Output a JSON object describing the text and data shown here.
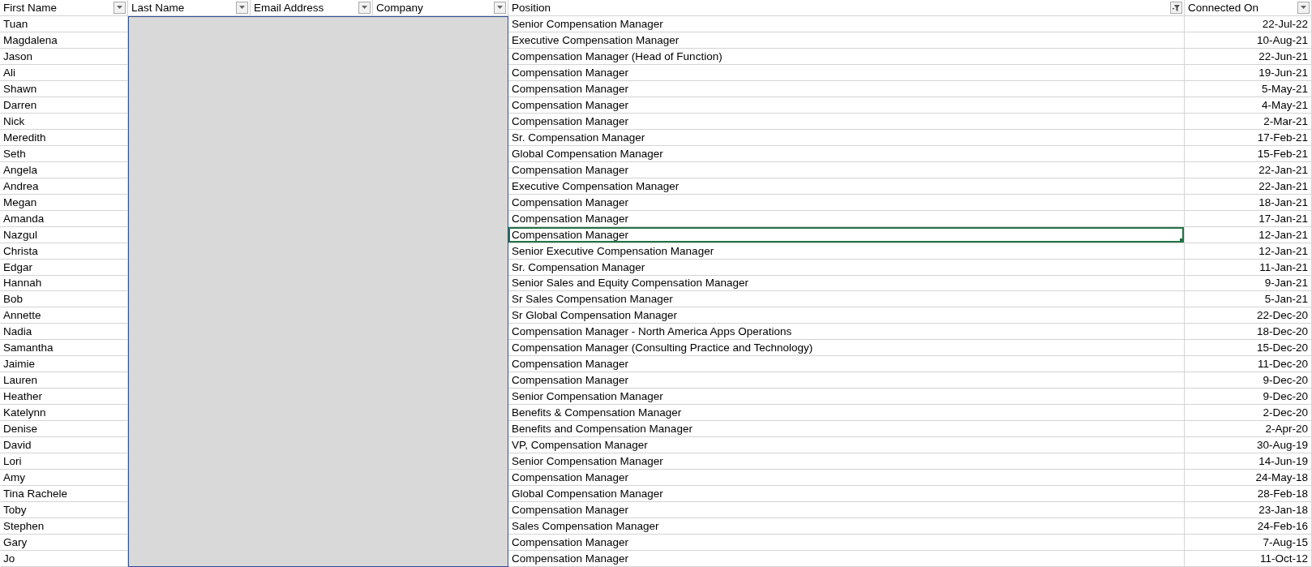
{
  "columns": [
    {
      "label": "First Name",
      "kind": "dropdown"
    },
    {
      "label": "Last Name",
      "kind": "dropdown"
    },
    {
      "label": "Email Address",
      "kind": "dropdown"
    },
    {
      "label": "Company",
      "kind": "dropdown"
    },
    {
      "label": "Position",
      "kind": "filtered"
    },
    {
      "label": "Connected On",
      "kind": "dropdown"
    }
  ],
  "rows": [
    {
      "first_name": "Tuan",
      "position": "Senior Compensation Manager",
      "connected_on": "22-Jul-22",
      "selected": false
    },
    {
      "first_name": "Magdalena",
      "position": "Executive Compensation Manager",
      "connected_on": "10-Aug-21",
      "selected": false
    },
    {
      "first_name": "Jason",
      "position": "Compensation Manager (Head of Function)",
      "connected_on": "22-Jun-21",
      "selected": false
    },
    {
      "first_name": "Ali",
      "position": "Compensation Manager",
      "connected_on": "19-Jun-21",
      "selected": false
    },
    {
      "first_name": "Shawn",
      "position": "Compensation Manager",
      "connected_on": "5-May-21",
      "selected": false
    },
    {
      "first_name": "Darren",
      "position": "Compensation Manager",
      "connected_on": "4-May-21",
      "selected": false
    },
    {
      "first_name": "Nick",
      "position": "Compensation Manager",
      "connected_on": "2-Mar-21",
      "selected": false
    },
    {
      "first_name": "Meredith",
      "position": "Sr. Compensation Manager",
      "connected_on": "17-Feb-21",
      "selected": false
    },
    {
      "first_name": "Seth",
      "position": "Global Compensation Manager",
      "connected_on": "15-Feb-21",
      "selected": false
    },
    {
      "first_name": "Angela",
      "position": "Compensation Manager",
      "connected_on": "22-Jan-21",
      "selected": false
    },
    {
      "first_name": "Andrea",
      "position": "Executive Compensation Manager",
      "connected_on": "22-Jan-21",
      "selected": false
    },
    {
      "first_name": "Megan",
      "position": "Compensation Manager",
      "connected_on": "18-Jan-21",
      "selected": false
    },
    {
      "first_name": "Amanda",
      "position": "Compensation Manager",
      "connected_on": "17-Jan-21",
      "selected": false
    },
    {
      "first_name": "Nazgul",
      "position": "Compensation Manager",
      "connected_on": "12-Jan-21",
      "selected": true
    },
    {
      "first_name": "Christa",
      "position": "Senior Executive Compensation Manager",
      "connected_on": "12-Jan-21",
      "selected": false
    },
    {
      "first_name": "Edgar",
      "position": "Sr. Compensation Manager",
      "connected_on": "11-Jan-21",
      "selected": false
    },
    {
      "first_name": "Hannah",
      "position": "Senior Sales and Equity Compensation Manager",
      "connected_on": "9-Jan-21",
      "selected": false
    },
    {
      "first_name": "Bob",
      "position": "Sr Sales Compensation Manager",
      "connected_on": "5-Jan-21",
      "selected": false
    },
    {
      "first_name": "Annette",
      "position": "Sr Global Compensation Manager",
      "connected_on": "22-Dec-20",
      "selected": false
    },
    {
      "first_name": "Nadia",
      "position": "Compensation Manager - North America Apps Operations",
      "connected_on": "18-Dec-20",
      "selected": false
    },
    {
      "first_name": "Samantha",
      "position": "Compensation Manager (Consulting Practice and Technology)",
      "connected_on": "15-Dec-20",
      "selected": false
    },
    {
      "first_name": "Jaimie",
      "position": "Compensation Manager",
      "connected_on": "11-Dec-20",
      "selected": false
    },
    {
      "first_name": "Lauren",
      "position": "Compensation Manager",
      "connected_on": "9-Dec-20",
      "selected": false
    },
    {
      "first_name": "Heather",
      "position": "Senior Compensation Manager",
      "connected_on": "9-Dec-20",
      "selected": false
    },
    {
      "first_name": "Katelynn",
      "position": "Benefits & Compensation Manager",
      "connected_on": "2-Dec-20",
      "selected": false
    },
    {
      "first_name": "Denise",
      "position": "Benefits and Compensation Manager",
      "connected_on": "2-Apr-20",
      "selected": false
    },
    {
      "first_name": "David",
      "position": "VP, Compensation Manager",
      "connected_on": "30-Aug-19",
      "selected": false
    },
    {
      "first_name": "Lori",
      "position": "Senior Compensation Manager",
      "connected_on": "14-Jun-19",
      "selected": false
    },
    {
      "first_name": "Amy",
      "position": "Compensation Manager",
      "connected_on": "24-May-18",
      "selected": false
    },
    {
      "first_name": "Tina Rachele",
      "position": "Global Compensation Manager",
      "connected_on": "28-Feb-18",
      "selected": false
    },
    {
      "first_name": "Toby",
      "position": "Compensation Manager",
      "connected_on": "23-Jan-18",
      "selected": false
    },
    {
      "first_name": "Stephen",
      "position": "Sales Compensation Manager",
      "connected_on": "24-Feb-16",
      "selected": false
    },
    {
      "first_name": "Gary",
      "position": "Compensation Manager",
      "connected_on": "7-Aug-15",
      "selected": false
    },
    {
      "first_name": "Jo",
      "position": "Compensation Manager",
      "connected_on": "11-Oct-12",
      "selected": false
    }
  ]
}
